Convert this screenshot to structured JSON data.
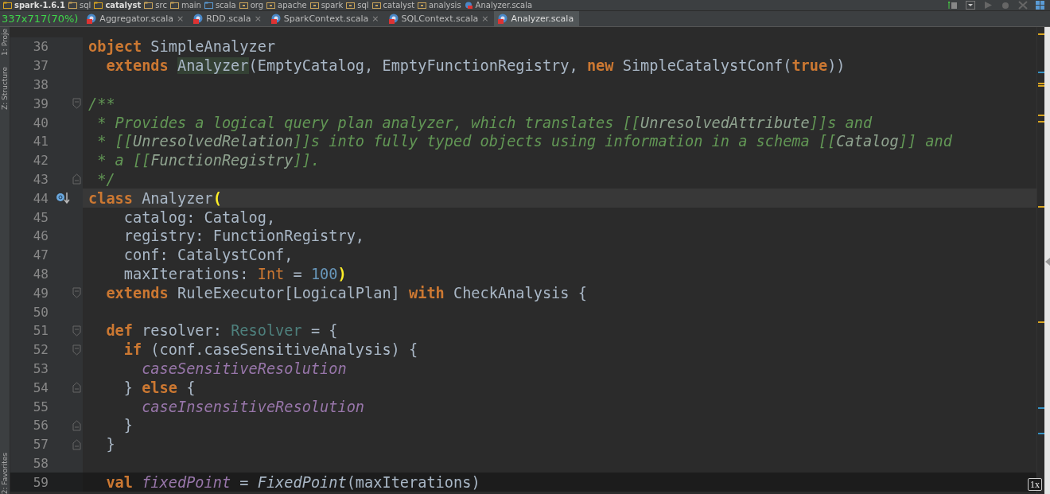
{
  "size_indicator": "337x717(70%)",
  "breadcrumbs": [
    {
      "label": "spark-1.6.1",
      "kind": "module",
      "bold": true
    },
    {
      "label": "sql",
      "kind": "folder",
      "bold": false
    },
    {
      "label": "catalyst",
      "kind": "module",
      "bold": true
    },
    {
      "label": "src",
      "kind": "folder",
      "bold": false
    },
    {
      "label": "main",
      "kind": "folder",
      "bold": false
    },
    {
      "label": "scala",
      "kind": "source",
      "bold": false
    },
    {
      "label": "org",
      "kind": "package",
      "bold": false
    },
    {
      "label": "apache",
      "kind": "package",
      "bold": false
    },
    {
      "label": "spark",
      "kind": "package",
      "bold": false
    },
    {
      "label": "sql",
      "kind": "package",
      "bold": false
    },
    {
      "label": "catalyst",
      "kind": "package",
      "bold": false
    },
    {
      "label": "analysis",
      "kind": "package",
      "bold": false
    },
    {
      "label": "Analyzer.scala",
      "kind": "file",
      "bold": false
    }
  ],
  "tool_windows": [
    {
      "label": "1: Proje"
    },
    {
      "label": "Z: Structure"
    },
    {
      "label": "2: Favorites"
    }
  ],
  "tabs": [
    {
      "label": "Aggregator.scala",
      "selected": false,
      "close": "×"
    },
    {
      "label": "RDD.scala",
      "selected": false,
      "close": "×"
    },
    {
      "label": "SparkContext.scala",
      "selected": false,
      "close": "×"
    },
    {
      "label": "SQLContext.scala",
      "selected": false,
      "close": "×"
    },
    {
      "label": "Analyzer.scala",
      "selected": true
    }
  ],
  "lines": [
    {
      "number": "36",
      "tokens": [
        {
          "kind": "kw",
          "s": "object"
        },
        {
          "kind": "plain",
          "s": " SimpleAnalyzer"
        }
      ]
    },
    {
      "number": "37",
      "tokens": [
        {
          "kind": "kw",
          "s": "  extends "
        },
        {
          "kind": "usage",
          "s": "Analyzer"
        },
        {
          "kind": "plain",
          "s": "(EmptyCatalog, EmptyFunctionRegistry, "
        },
        {
          "kind": "kw",
          "s": "new"
        },
        {
          "kind": "plain",
          "s": " SimpleCatalystConf("
        },
        {
          "kind": "kw",
          "s": "true"
        },
        {
          "kind": "plain",
          "s": "))"
        }
      ]
    },
    {
      "number": "38"
    },
    {
      "number": "39",
      "fold_start": true,
      "tokens": [
        {
          "kind": "comment",
          "s": "/**"
        }
      ]
    },
    {
      "number": "40",
      "tokens": [
        {
          "kind": "comment",
          "s": " * Provides a logical query plan analyzer, which translates [["
        },
        {
          "kind": "ref",
          "s": "UnresolvedAttribute"
        },
        {
          "kind": "comment",
          "s": "]]s and"
        }
      ]
    },
    {
      "number": "41",
      "tokens": [
        {
          "kind": "comment",
          "s": " * [["
        },
        {
          "kind": "ref",
          "s": "UnresolvedRelation"
        },
        {
          "kind": "comment",
          "s": "]]s into fully typed objects using information in a schema [["
        },
        {
          "kind": "ref",
          "s": "Catalog"
        },
        {
          "kind": "comment",
          "s": "]] and"
        }
      ]
    },
    {
      "number": "42",
      "tokens": [
        {
          "kind": "comment",
          "s": " * a [["
        },
        {
          "kind": "ref",
          "s": "FunctionRegistry"
        },
        {
          "kind": "comment",
          "s": "]]."
        }
      ]
    },
    {
      "number": "43",
      "fold_end": true,
      "tokens": [
        {
          "kind": "comment",
          "s": " */"
        }
      ]
    },
    {
      "number": "44",
      "current": true,
      "override_marker": true,
      "tokens": [
        {
          "kind": "kw",
          "s": "class"
        },
        {
          "kind": "plain",
          "s": " Analyzer"
        },
        {
          "kind": "match",
          "s": "("
        }
      ]
    },
    {
      "number": "45",
      "tokens": [
        {
          "kind": "plain",
          "s": "    catalog: Catalog,"
        }
      ]
    },
    {
      "number": "46",
      "tokens": [
        {
          "kind": "plain",
          "s": "    registry: FunctionRegistry,"
        }
      ]
    },
    {
      "number": "47",
      "tokens": [
        {
          "kind": "plain",
          "s": "    conf: CatalystConf,"
        }
      ]
    },
    {
      "number": "48",
      "tokens": [
        {
          "kind": "plain",
          "s": "    maxIterations: "
        },
        {
          "kind": "typeref",
          "s": "Int"
        },
        {
          "kind": "plain",
          "s": " = "
        },
        {
          "kind": "number",
          "s": "100"
        },
        {
          "kind": "match",
          "s": ")"
        }
      ]
    },
    {
      "number": "49",
      "fold_start": true,
      "tokens": [
        {
          "kind": "kw",
          "s": "  extends"
        },
        {
          "kind": "plain",
          "s": " RuleExecutor[LogicalPlan] "
        },
        {
          "kind": "kw",
          "s": "with"
        },
        {
          "kind": "plain",
          "s": " CheckAnalysis {"
        }
      ]
    },
    {
      "number": "50"
    },
    {
      "number": "51",
      "fold_start": true,
      "tokens": [
        {
          "kind": "kw",
          "s": "  def"
        },
        {
          "kind": "plain",
          "s": " resolver: "
        },
        {
          "kind": "alias",
          "s": "Resolver"
        },
        {
          "kind": "plain",
          "s": " = {"
        }
      ]
    },
    {
      "number": "52",
      "fold_start": true,
      "tokens": [
        {
          "kind": "kw",
          "s": "    if"
        },
        {
          "kind": "plain",
          "s": " (conf.caseSensitiveAnalysis) {"
        }
      ]
    },
    {
      "number": "53",
      "tokens": [
        {
          "kind": "field",
          "s": "      caseSensitiveResolution"
        }
      ]
    },
    {
      "number": "54",
      "fold_end": true,
      "tokens": [
        {
          "kind": "plain",
          "s": "    } "
        },
        {
          "kind": "kw",
          "s": "else"
        },
        {
          "kind": "plain",
          "s": " {"
        }
      ]
    },
    {
      "number": "55",
      "tokens": [
        {
          "kind": "field",
          "s": "      caseInsensitiveResolution"
        }
      ]
    },
    {
      "number": "56",
      "fold_end": true,
      "tokens": [
        {
          "kind": "plain",
          "s": "    }"
        }
      ]
    },
    {
      "number": "57",
      "fold_end": true,
      "tokens": [
        {
          "kind": "plain",
          "s": "  }"
        }
      ]
    },
    {
      "number": "58"
    },
    {
      "number": "59",
      "dimmed": true,
      "tokens": [
        {
          "kind": "kw",
          "s": "  val "
        },
        {
          "kind": "field",
          "s": "fixedPoint"
        },
        {
          "kind": "plain",
          "s": " = "
        },
        {
          "kind": "italic",
          "s": "FixedPoint"
        },
        {
          "kind": "plain",
          "s": "(maxIterations)"
        }
      ]
    }
  ],
  "stripe_marks": [
    {
      "color": "#d9a520"
    },
    {
      "color": "#3592c4"
    },
    {
      "color": "#d9a520"
    },
    {
      "color": "#d9a520"
    },
    {
      "color": "#d9a520"
    },
    {
      "color": "#d9a520"
    },
    {
      "color": "#d9a520"
    },
    {
      "color": "#d9a520"
    },
    {
      "color": "#3592c4"
    },
    {
      "color": "#3592c4"
    }
  ],
  "zoom_badge": "1x"
}
